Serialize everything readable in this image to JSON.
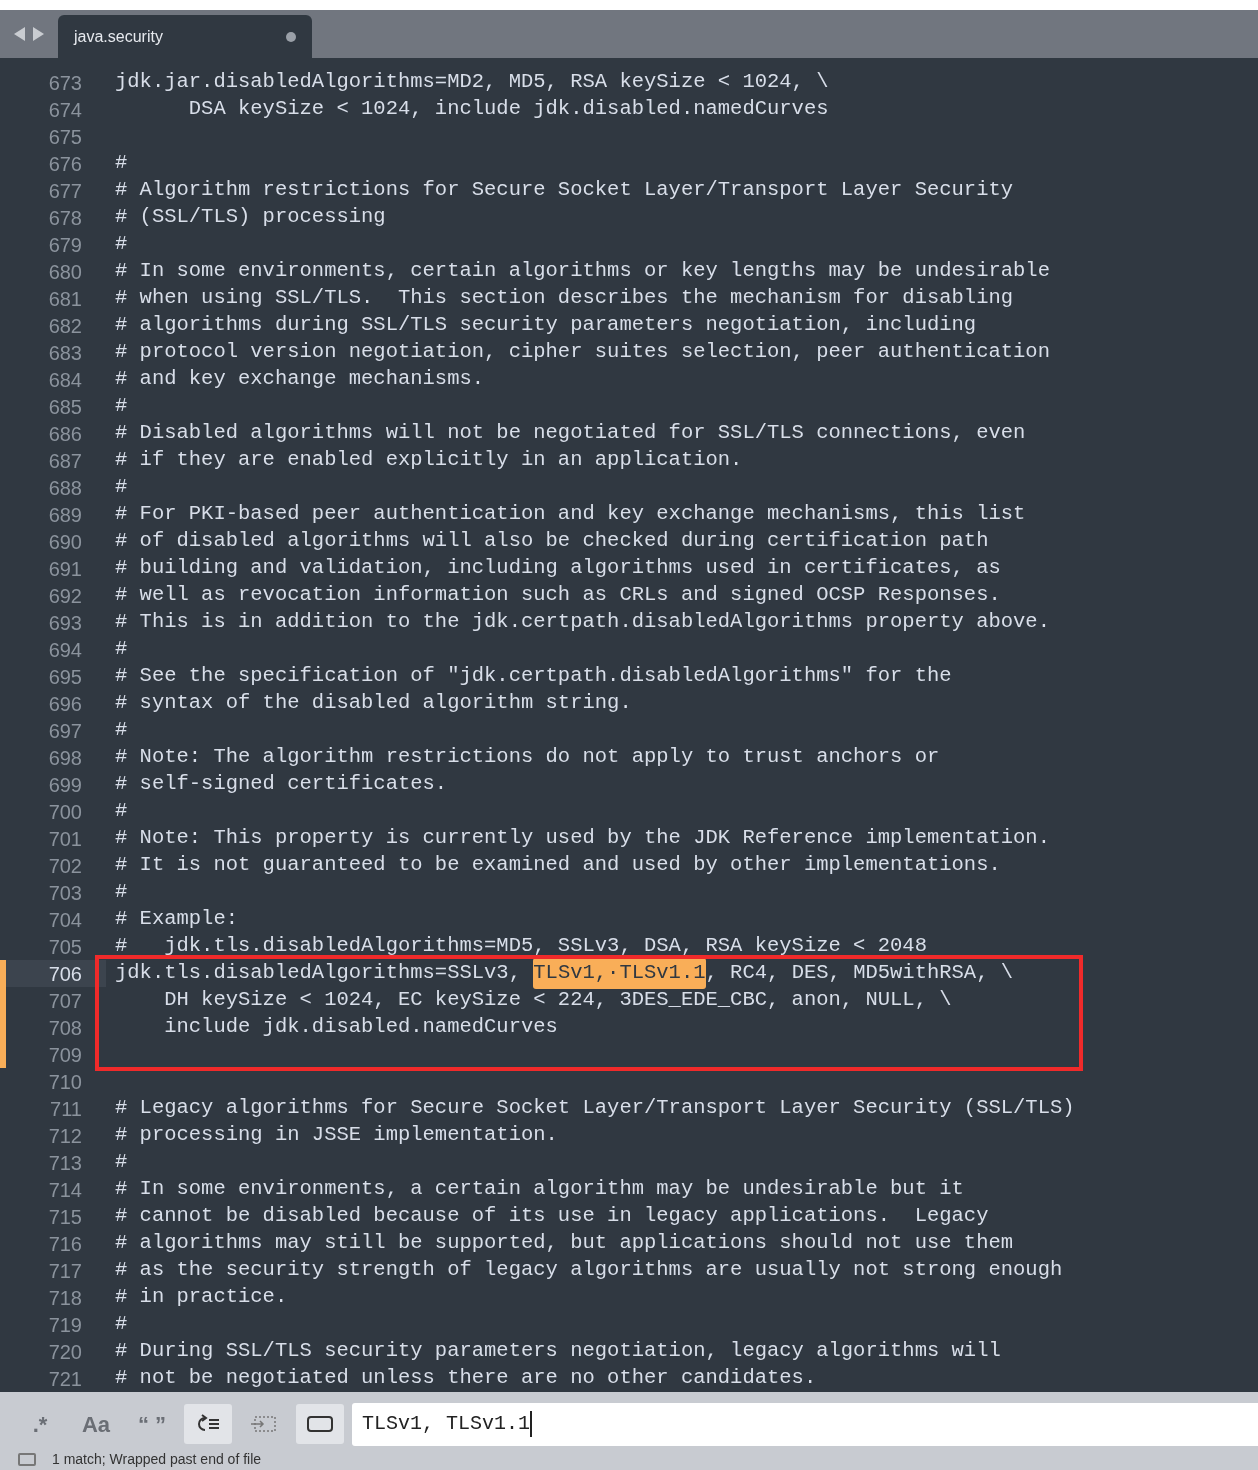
{
  "tab_bar": {
    "tabs": [
      {
        "label": "java.security",
        "selected": true,
        "unsaved": true
      }
    ]
  },
  "editor": {
    "lines": [
      {
        "number": "673",
        "text": "jdk.jar.disabledAlgorithms=MD2, MD5, RSA keySize < 1024, \\",
        "modified": false,
        "current": false,
        "boxed": false
      },
      {
        "number": "674",
        "text": "      DSA keySize < 1024, include jdk.disabled.namedCurves",
        "modified": false,
        "current": false,
        "boxed": false
      },
      {
        "number": "675",
        "modified": false,
        "current": false,
        "boxed": false
      },
      {
        "number": "676",
        "text": "#",
        "modified": false,
        "current": false,
        "boxed": false
      },
      {
        "number": "677",
        "text": "# Algorithm restrictions for Secure Socket Layer/Transport Layer Security",
        "modified": false,
        "current": false,
        "boxed": false
      },
      {
        "number": "678",
        "text": "# (SSL/TLS) processing",
        "modified": false,
        "current": false,
        "boxed": false
      },
      {
        "number": "679",
        "text": "#",
        "modified": false,
        "current": false,
        "boxed": false
      },
      {
        "number": "680",
        "text": "# In some environments, certain algorithms or key lengths may be undesirable",
        "modified": false,
        "current": false,
        "boxed": false
      },
      {
        "number": "681",
        "text": "# when using SSL/TLS.  This section describes the mechanism for disabling",
        "modified": false,
        "current": false,
        "boxed": false
      },
      {
        "number": "682",
        "text": "# algorithms during SSL/TLS security parameters negotiation, including",
        "modified": false,
        "current": false,
        "boxed": false
      },
      {
        "number": "683",
        "text": "# protocol version negotiation, cipher suites selection, peer authentication",
        "modified": false,
        "current": false,
        "boxed": false
      },
      {
        "number": "684",
        "text": "# and key exchange mechanisms.",
        "modified": false,
        "current": false,
        "boxed": false
      },
      {
        "number": "685",
        "text": "#",
        "modified": false,
        "current": false,
        "boxed": false
      },
      {
        "number": "686",
        "text": "# Disabled algorithms will not be negotiated for SSL/TLS connections, even",
        "modified": false,
        "current": false,
        "boxed": false
      },
      {
        "number": "687",
        "text": "# if they are enabled explicitly in an application.",
        "modified": false,
        "current": false,
        "boxed": false
      },
      {
        "number": "688",
        "text": "#",
        "modified": false,
        "current": false,
        "boxed": false
      },
      {
        "number": "689",
        "text": "# For PKI-based peer authentication and key exchange mechanisms, this list",
        "modified": false,
        "current": false,
        "boxed": false
      },
      {
        "number": "690",
        "text": "# of disabled algorithms will also be checked during certification path",
        "modified": false,
        "current": false,
        "boxed": false
      },
      {
        "number": "691",
        "text": "# building and validation, including algorithms used in certificates, as",
        "modified": false,
        "current": false,
        "boxed": false
      },
      {
        "number": "692",
        "text": "# well as revocation information such as CRLs and signed OCSP Responses.",
        "modified": false,
        "current": false,
        "boxed": false
      },
      {
        "number": "693",
        "text": "# This is in addition to the jdk.certpath.disabledAlgorithms property above.",
        "modified": false,
        "current": false,
        "boxed": false
      },
      {
        "number": "694",
        "text": "#",
        "modified": false,
        "current": false,
        "boxed": false
      },
      {
        "number": "695",
        "text": "# See the specification of \"jdk.certpath.disabledAlgorithms\" for the",
        "modified": false,
        "current": false,
        "boxed": false
      },
      {
        "number": "696",
        "text": "# syntax of the disabled algorithm string.",
        "modified": false,
        "current": false,
        "boxed": false
      },
      {
        "number": "697",
        "text": "#",
        "modified": false,
        "current": false,
        "boxed": false
      },
      {
        "number": "698",
        "text": "# Note: The algorithm restrictions do not apply to trust anchors or",
        "modified": false,
        "current": false,
        "boxed": false
      },
      {
        "number": "699",
        "text": "# self-signed certificates.",
        "modified": false,
        "current": false,
        "boxed": false
      },
      {
        "number": "700",
        "text": "#",
        "modified": false,
        "current": false,
        "boxed": false
      },
      {
        "number": "701",
        "text": "# Note: This property is currently used by the JDK Reference implementation.",
        "modified": false,
        "current": false,
        "boxed": false
      },
      {
        "number": "702",
        "text": "# It is not guaranteed to be examined and used by other implementations.",
        "modified": false,
        "current": false,
        "boxed": false
      },
      {
        "number": "703",
        "text": "#",
        "modified": false,
        "current": false,
        "boxed": false
      },
      {
        "number": "704",
        "text": "# Example:",
        "modified": false,
        "current": false,
        "boxed": false
      },
      {
        "number": "705",
        "text": "#   jdk.tls.disabledAlgorithms=MD5, SSLv3, DSA, RSA keySize < 2048",
        "modified": false,
        "current": false,
        "boxed": false
      },
      {
        "number": "706",
        "text": "jdk.tls.disabledAlgorithms=SSLv3, ",
        "match": "TLSv1,·TLSv1.1",
        "after": ", RC4, DES, MD5withRSA, \\",
        "modified": true,
        "current": true,
        "boxed": true
      },
      {
        "number": "707",
        "text": "    DH keySize < 1024, EC keySize < 224, 3DES_EDE_CBC, anon, NULL, \\",
        "modified": true,
        "current": false,
        "boxed": true
      },
      {
        "number": "708",
        "text": "    include jdk.disabled.namedCurves",
        "modified": true,
        "current": false,
        "boxed": true
      },
      {
        "number": "709",
        "modified": true,
        "current": false,
        "boxed": true
      },
      {
        "number": "710",
        "modified": false,
        "current": false,
        "boxed": false
      },
      {
        "number": "711",
        "text": "# Legacy algorithms for Secure Socket Layer/Transport Layer Security (SSL/TLS)",
        "modified": false,
        "current": false,
        "boxed": false
      },
      {
        "number": "712",
        "text": "# processing in JSSE implementation.",
        "modified": false,
        "current": false,
        "boxed": false
      },
      {
        "number": "713",
        "text": "#",
        "modified": false,
        "current": false,
        "boxed": false
      },
      {
        "number": "714",
        "text": "# In some environments, a certain algorithm may be undesirable but it",
        "modified": false,
        "current": false,
        "boxed": false
      },
      {
        "number": "715",
        "text": "# cannot be disabled because of its use in legacy applications.  Legacy",
        "modified": false,
        "current": false,
        "boxed": false
      },
      {
        "number": "716",
        "text": "# algorithms may still be supported, but applications should not use them",
        "modified": false,
        "current": false,
        "boxed": false
      },
      {
        "number": "717",
        "text": "# as the security strength of legacy algorithms are usually not strong enough",
        "modified": false,
        "current": false,
        "boxed": false
      },
      {
        "number": "718",
        "text": "# in practice.",
        "modified": false,
        "current": false,
        "boxed": false
      },
      {
        "number": "719",
        "text": "#",
        "modified": false,
        "current": false,
        "boxed": false
      },
      {
        "number": "720",
        "text": "# During SSL/TLS security parameters negotiation, legacy algorithms will",
        "modified": false,
        "current": false,
        "boxed": false
      },
      {
        "number": "721",
        "text": "# not be negotiated unless there are no other candidates.",
        "modified": false,
        "current": false,
        "boxed": false
      }
    ]
  },
  "find_bar": {
    "toggles": [
      {
        "kind": "text",
        "label": ".*",
        "on": false
      },
      {
        "kind": "text",
        "label": "Aa",
        "on": false
      },
      {
        "kind": "text",
        "label": "“ ”",
        "on": false
      },
      {
        "kind": "icon",
        "on": true
      },
      {
        "kind": "icon",
        "on": false
      },
      {
        "kind": "icon",
        "on": true
      }
    ],
    "value": "TLSv1, TLSv1.1"
  },
  "status_bar": {
    "text": "1 match; Wrapped past end of file"
  }
}
